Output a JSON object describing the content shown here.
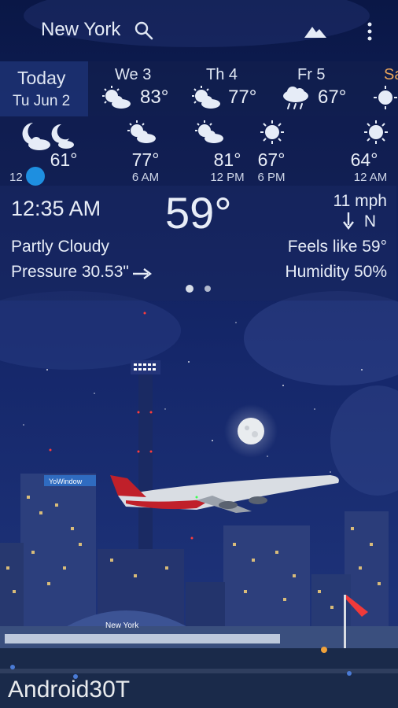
{
  "header": {
    "city": "New York",
    "search_icon": "search-icon",
    "landscape_icon": "landscape-icon",
    "menu_icon": "more-vert-icon"
  },
  "forecast": {
    "today": {
      "label": "Today",
      "date": "Tu Jun 2"
    },
    "days": [
      {
        "name": "We 3",
        "temp": "83°",
        "icon": "partly-sunny-icon"
      },
      {
        "name": "Th 4",
        "temp": "77°",
        "icon": "partly-sunny-icon"
      },
      {
        "name": "Fr 5",
        "temp": "67°",
        "icon": "rain-cloud-icon"
      },
      {
        "name": "Sa",
        "temp": "",
        "icon": "sun-icon"
      }
    ]
  },
  "hourly": [
    {
      "temp": "61°",
      "time": "",
      "icon": "night-cloudy-icon"
    },
    {
      "temp": "77°",
      "time": "6 AM",
      "icon": "partly-sunny-icon"
    },
    {
      "temp": "81°",
      "time": "12 PM",
      "icon": "partly-sunny-icon"
    },
    {
      "temp": "67°",
      "time": "6 PM",
      "icon": "sun-icon"
    },
    {
      "temp": "64°",
      "time": "12 AM",
      "icon": "sun-icon"
    }
  ],
  "timeline": {
    "now_label": "12"
  },
  "current": {
    "time": "12:35 AM",
    "temperature": "59°",
    "wind_speed": "11 mph",
    "wind_dir": "N",
    "condition": "Partly Cloudy",
    "feels_like": "Feels like 59°",
    "pressure": "Pressure 30.53\"",
    "humidity": "Humidity 50%"
  },
  "scene": {
    "billboard": "YoWindow",
    "station_sign": "New York"
  },
  "watermark": "Android30T",
  "colors": {
    "sky_top": "#0b1a4a",
    "sky_bottom": "#1b2e6e",
    "accent_blue": "#1e8fe0"
  }
}
